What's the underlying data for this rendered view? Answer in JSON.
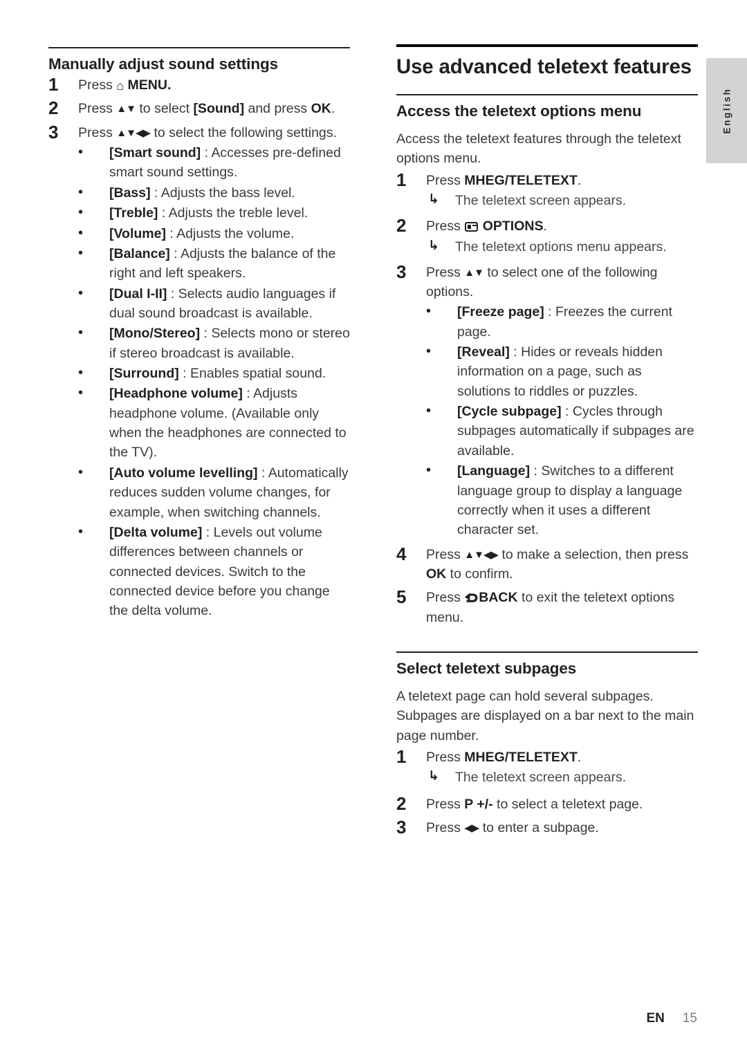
{
  "page": {
    "language_tab": "English",
    "footer": {
      "locale_code": "EN",
      "page_number": "15"
    }
  },
  "left_column": {
    "heading": "Manually adjust sound settings",
    "steps": [
      {
        "number": "1",
        "text_before": "Press ",
        "icon": "home-icon",
        "text_after_icon": " MENU."
      },
      {
        "number": "2",
        "text_before": "Press ",
        "icon": "up-down-arrows-icon",
        "mid": " to select ",
        "bold1": "[Sound]",
        "mid2": " and press ",
        "bold2": "OK",
        "tail": "."
      },
      {
        "number": "3",
        "text_before": "Press ",
        "icon": "four-direction-arrows-icon",
        "text_after_icon": " to select the following settings."
      }
    ],
    "bullets": [
      {
        "term": "[Smart sound]",
        "desc": " : Accesses pre-defined smart sound settings."
      },
      {
        "term": "[Bass]",
        "desc": " : Adjusts the bass level."
      },
      {
        "term": "[Treble]",
        "desc": " : Adjusts the treble level."
      },
      {
        "term": "[Volume]",
        "desc": " : Adjusts the volume."
      },
      {
        "term": "[Balance]",
        "desc": " : Adjusts the balance of the right and left speakers."
      },
      {
        "term": "[Dual I-II]",
        "desc": " : Selects audio languages if dual sound broadcast is available."
      },
      {
        "term": "[Mono/Stereo]",
        "desc": " : Selects mono or stereo if stereo broadcast is available."
      },
      {
        "term": "[Surround]",
        "desc": " : Enables spatial sound."
      },
      {
        "term": "[Headphone volume]",
        "desc": " : Adjusts headphone volume. (Available only when the headphones are connected to the TV)."
      },
      {
        "term": "[Auto volume levelling]",
        "desc": " : Automatically reduces sudden volume changes, for example, when switching channels."
      },
      {
        "term": "[Delta volume]",
        "desc": " : Levels out volume differences between channels or connected devices. Switch to the connected device before you change the delta volume."
      }
    ]
  },
  "right_column": {
    "chapter_title": "Use advanced teletext features",
    "section_1": {
      "heading": "Access the teletext options menu",
      "intro": "Access the teletext features through the teletext options menu.",
      "step1": {
        "number": "1",
        "text_before": "Press ",
        "bold": "MHEG/TELETEXT",
        "tail": "."
      },
      "step1_result": "The teletext screen appears.",
      "step2": {
        "number": "2",
        "text_before": "Press ",
        "icon": "options-icon",
        "bold": "OPTIONS",
        "tail": "."
      },
      "step2_result": "The teletext options menu appears.",
      "step3": {
        "number": "3",
        "text_before": "Press ",
        "icon": "up-down-arrows-icon",
        "text_after_icon": " to select one of the following options."
      },
      "step3_bullets": [
        {
          "term": "[Freeze page]",
          "desc": " : Freezes the current page."
        },
        {
          "term": "[Reveal]",
          "desc": " : Hides or reveals hidden information on a page, such as solutions to riddles or puzzles."
        },
        {
          "term": "[Cycle subpage]",
          "desc": " : Cycles through subpages automatically if subpages are available."
        },
        {
          "term": "[Language]",
          "desc": " : Switches to a different language group to display a language correctly when it uses a different character set."
        }
      ],
      "step4": {
        "number": "4",
        "text_before": "Press ",
        "icon": "four-direction-arrows-icon",
        "mid": " to make a selection, then press ",
        "bold": "OK",
        "tail": " to confirm."
      },
      "step5": {
        "number": "5",
        "text_before": "Press ",
        "icon": "back-icon",
        "bold": "BACK",
        "tail": " to exit the teletext options menu."
      }
    },
    "section_2": {
      "heading": "Select teletext subpages",
      "intro": "A teletext page can hold several subpages. Subpages are displayed on a bar next to the main page number.",
      "step1": {
        "number": "1",
        "text_before": "Press ",
        "bold": "MHEG/TELETEXT",
        "tail": "."
      },
      "step1_result": "The teletext screen appears.",
      "step2": {
        "number": "2",
        "text_before": "Press ",
        "bold": "P +/-",
        "tail": " to select a teletext page."
      },
      "step3": {
        "number": "3",
        "text_before": "Press ",
        "icon": "left-right-arrows-icon",
        "text_after_icon": " to enter a subpage."
      }
    }
  },
  "icons": {
    "home": "⌂",
    "up_down": "▲▼",
    "four_dir": "▲▼◀▶",
    "left_right": "◀▶",
    "result_arrow": "↳",
    "bullet_dot": "•"
  }
}
